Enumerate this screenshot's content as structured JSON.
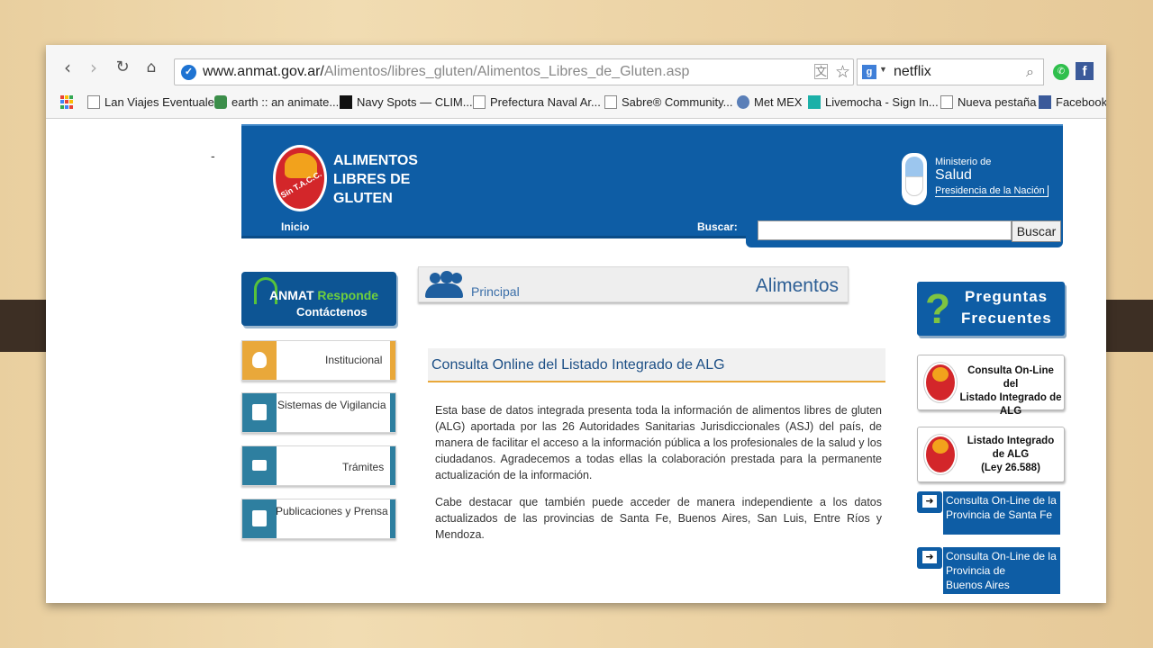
{
  "browser": {
    "url_host": "www.anmat.gov.ar/",
    "url_path": "Alimentos/libres_gluten/Alimentos_Libres_de_Gluten.asp",
    "search_value": "netflix",
    "bookmarks": [
      "Lan Viajes Eventuales",
      "earth :: an animate...",
      "Navy Spots — CLIM...",
      "Prefectura Naval Ar...",
      "Sabre® Community...",
      "Met MEX",
      "Livemocha - Sign In...",
      "Nueva pestaña",
      "Facebook"
    ]
  },
  "header": {
    "dash": "-",
    "logo_text": "Sin T.A.C.C.",
    "title_lines": [
      "ALIMENTOS",
      "LIBRES DE",
      "GLUTEN"
    ],
    "ministerio_l1": "Ministerio de",
    "ministerio_l2": "Salud",
    "ministerio_l3": "Presidencia de la Nación",
    "nav_inicio": "Inicio",
    "nav_buscar": "Buscar:",
    "search_button": "Buscar"
  },
  "left": {
    "anmat_l1a": "ANMAT ",
    "anmat_l1b": "Responde",
    "anmat_l2": "Contáctenos",
    "menu": [
      {
        "label": "Institucional",
        "color": "#e9a83a"
      },
      {
        "label": "Sistemas de Vigilancia",
        "color": "#2e7fa0"
      },
      {
        "label": "Trámites",
        "color": "#2e7fa0"
      },
      {
        "label": "Publicaciones y Prensa",
        "color": "#2e7fa0"
      }
    ]
  },
  "center": {
    "principal": "Principal",
    "section": "Alimentos",
    "consulta_title": "Consulta Online del Listado Integrado de ALG",
    "paragraph1": "Esta base de datos integrada presenta toda la información de alimentos libres de gluten (ALG) aportada por las 26 Autoridades Sanitarias Jurisdiccionales (ASJ) del país, de manera de facilitar el acceso a la información pública a los profesionales de la salud y los ciudadanos. Agradecemos a todas ellas la colaboración prestada para la permanente actualización de la información.",
    "paragraph2": "Cabe destacar que también puede acceder de manera independiente a los datos actualizados de las provincias de Santa Fe, Buenos Aires, San Luis, Entre Ríos y Mendoza."
  },
  "right": {
    "faq_q": "?",
    "faq_l1": "Preguntas",
    "faq_l2": "Frecuentes",
    "alg1": [
      "Consulta On-Line del",
      "Listado Integrado de",
      "ALG"
    ],
    "alg2": [
      "Listado Integrado",
      "de ALG",
      "(Ley 26.588)"
    ],
    "prov1": [
      "Consulta On-Line de la",
      "Provincia de Santa Fe"
    ],
    "prov2": [
      "Consulta On-Line de la",
      "Provincia de",
      "Buenos Aires"
    ]
  },
  "colors": {
    "header_blue": "#0e5da5",
    "accent_orange": "#e9a83a",
    "anmat_green": "#6fcf3d"
  }
}
